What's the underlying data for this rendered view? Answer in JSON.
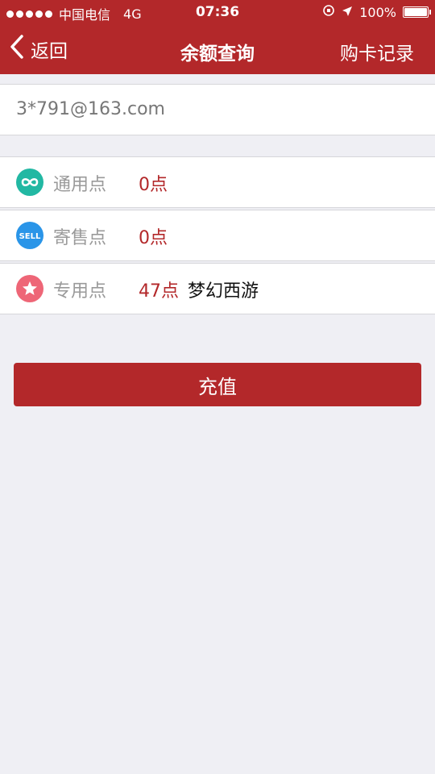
{
  "status_bar": {
    "carrier": "中国电信",
    "network": "4G",
    "time": "07:36",
    "battery_text": "100%",
    "battery_level": 1.0
  },
  "nav": {
    "back_label": "返回",
    "title": "余额查询",
    "right_label": "购卡记录"
  },
  "account": {
    "email": "3*791@163.com"
  },
  "balances": [
    {
      "label": "通用点",
      "value": "0点",
      "game": "",
      "icon": "infinity-icon",
      "color": "#22b8a3"
    },
    {
      "label": "寄售点",
      "value": "0点",
      "game": "",
      "icon": "sell-icon",
      "color": "#2a95e8"
    },
    {
      "label": "专用点",
      "value": "47点",
      "game": "梦幻西游",
      "icon": "star-icon",
      "color": "#ee6677"
    }
  ],
  "sell_icon_text": "SELL",
  "recharge_label": "充值",
  "colors": {
    "brand": "#b3282a",
    "background": "#efeff4"
  }
}
